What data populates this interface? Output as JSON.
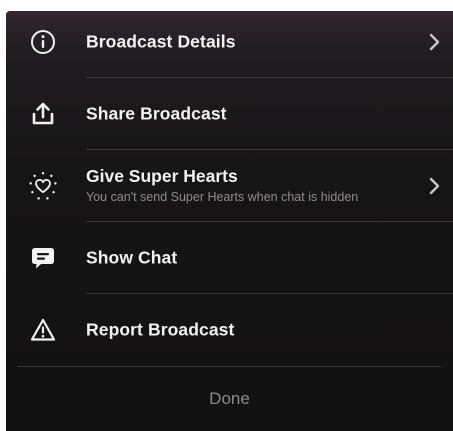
{
  "menu": {
    "items": [
      {
        "label": "Broadcast Details",
        "icon": "info-icon",
        "has_chevron": true
      },
      {
        "label": "Share Broadcast",
        "icon": "share-icon",
        "has_chevron": false
      },
      {
        "label": "Give Super Hearts",
        "sublabel": "You can't send Super Hearts when chat is hidden",
        "icon": "sparkle-heart-icon",
        "has_chevron": true
      },
      {
        "label": "Show Chat",
        "icon": "chat-bubble-icon",
        "has_chevron": false
      },
      {
        "label": "Report Broadcast",
        "icon": "warning-icon",
        "has_chevron": false
      }
    ],
    "done_label": "Done"
  },
  "colors": {
    "background": "#141313",
    "text_primary": "#f2f2f2",
    "text_secondary": "#8e8b8c",
    "divider": "#3a3839",
    "done_text": "#8c8a8b"
  }
}
